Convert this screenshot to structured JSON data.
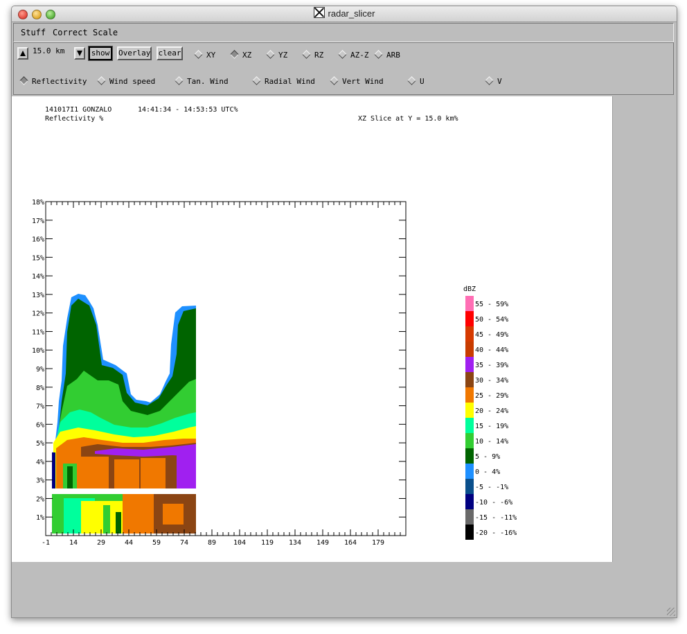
{
  "window": {
    "title": "radar_slicer"
  },
  "menu": [
    "Stuff",
    "Correct",
    "Scale"
  ],
  "toolbar": {
    "height_value": "15.0 km",
    "show_label": "show",
    "overlay_label": "Overlay",
    "clear_label": "clear",
    "slice_modes": [
      "XY",
      "XZ",
      "YZ",
      "RZ",
      "AZ-Z",
      "ARB"
    ],
    "selected_slice_mode": "XZ",
    "fields": [
      "Reflectivity",
      "Wind speed",
      "Tan. Wind",
      "Radial Wind",
      "Vert Wind",
      "U",
      "V"
    ],
    "selected_field": "Reflectivity"
  },
  "plot": {
    "header_line1": "141017I1 GONZALO",
    "time_range": "14:41:34 - 14:53:53 UTC%",
    "header_line2": "Reflectivity %",
    "slice_info": "XZ Slice at Y = 15.0 km%"
  },
  "chart_data": {
    "type": "heatmap",
    "x_ticks": [
      "-1",
      "14",
      "29",
      "44",
      "59",
      "74",
      "89",
      "104",
      "119",
      "134",
      "149",
      "164",
      "179"
    ],
    "y_ticks": [
      "1%",
      "2%",
      "3%",
      "4%",
      "5%",
      "6%",
      "7%",
      "8%",
      "9%",
      "10%",
      "11%",
      "12%",
      "13%",
      "14%",
      "15%",
      "16%",
      "17%",
      "18%"
    ],
    "xlim": [
      -1,
      194
    ],
    "ylim": [
      0,
      18
    ],
    "legend_title": "dBZ",
    "legend": [
      {
        "label": "55 - 59%",
        "color": "#ff6eb4"
      },
      {
        "label": "50 - 54%",
        "color": "#ff0000"
      },
      {
        "label": "45 - 49%",
        "color": "#d63a00"
      },
      {
        "label": "40 - 44%",
        "color": "#c83c00"
      },
      {
        "label": "35 - 39%",
        "color": "#a020f0"
      },
      {
        "label": "30 - 34%",
        "color": "#8b4513"
      },
      {
        "label": "25 - 29%",
        "color": "#f07800"
      },
      {
        "label": "20 - 24%",
        "color": "#ffff00"
      },
      {
        "label": "15 - 19%",
        "color": "#00ff9c"
      },
      {
        "label": "10 - 14%",
        "color": "#32cd32"
      },
      {
        "label": "5 - 9%",
        "color": "#006400"
      },
      {
        "label": "0 - 4%",
        "color": "#1e90ff"
      },
      {
        "label": "-5 - -1%",
        "color": "#0a4f8c"
      },
      {
        "label": "-10 - -6%",
        "color": "#000080"
      },
      {
        "label": "-15 - -11%",
        "color": "#696969"
      },
      {
        "label": "-20 - -16%",
        "color": "#000000"
      }
    ]
  }
}
